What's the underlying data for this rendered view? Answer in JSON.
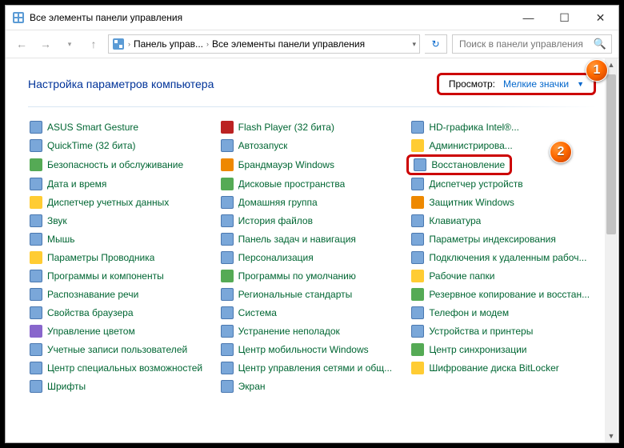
{
  "title": "Все элементы панели управления",
  "breadcrumbs": {
    "part1": "Панель управ...",
    "part2": "Все элементы панели управления"
  },
  "search": {
    "placeholder": "Поиск в панели управления"
  },
  "heading": "Настройка параметров компьютера",
  "view": {
    "label": "Просмотр:",
    "value": "Мелкие значки"
  },
  "badges": {
    "one": "1",
    "two": "2"
  },
  "items": {
    "col1": [
      "ASUS Smart Gesture",
      "QuickTime (32 бита)",
      "Безопасность и обслуживание",
      "Дата и время",
      "Диспетчер учетных данных",
      "Звук",
      "Мышь",
      "Параметры Проводника",
      "Программы и компоненты",
      "Распознавание речи",
      "Свойства браузера",
      "Управление цветом",
      "Учетные записи пользователей",
      "Центр специальных возможностей",
      "Шрифты"
    ],
    "col2": [
      "Flash Player (32 бита)",
      "Автозапуск",
      "Брандмауэр Windows",
      "Дисковые пространства",
      "Домашняя группа",
      "История файлов",
      "Панель задач и навигация",
      "Персонализация",
      "Программы по умолчанию",
      "Региональные стандарты",
      "Система",
      "Устранение неполадок",
      "Центр мобильности Windows",
      "Центр управления сетями и общ...",
      "Экран"
    ],
    "col3": [
      "HD-графика Intel®...",
      "Администрирова...",
      "Восстановление",
      "Диспетчер устройств",
      "Защитник Windows",
      "Клавиатура",
      "Параметры индексирования",
      "Подключения к удаленным рабоч...",
      "Рабочие папки",
      "Резервное копирование и восстан...",
      "Телефон и модем",
      "Устройства и принтеры",
      "Центр синхронизации",
      "Шифрование диска BitLocker"
    ]
  }
}
